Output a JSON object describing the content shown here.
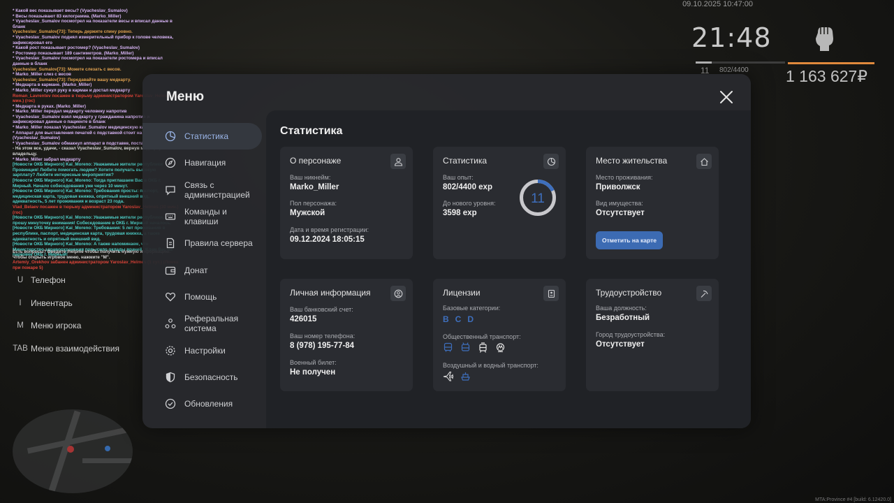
{
  "hud": {
    "date": "09.10.2025 10:47:00",
    "time": "21:48",
    "level": "11",
    "exp": "802/4400",
    "money": "1 163 627₽",
    "build": "MTA:Province #4 [build: 6.12420.0]"
  },
  "chat": [
    {
      "t": "* Какой вес показывает весы? (Vyacheslav_Sumalov)",
      "c": "c-sys"
    },
    {
      "t": "* Весы показывают 83 килограмма. (Marko_Miller)",
      "c": "c-sys"
    },
    {
      "t": "* Vyacheslav_Sumalov посмотрел на показатели весы и вписал данные в бланк",
      "c": "c-sys"
    },
    {
      "t": "Vyacheslav_Sumalov[73]: Теперь держите спину ровно.",
      "c": "c-orange"
    },
    {
      "t": "* Vyacheslav_Sumalov поднял измерительный прибор к голове человека, зафиксировал его",
      "c": "c-sys"
    },
    {
      "t": "* Какой рост показывает ростомер? (Vyacheslav_Sumalov)",
      "c": "c-sys"
    },
    {
      "t": "* Ростомер показывает 189 сантиметров. (Marko_Miller)",
      "c": "c-sys"
    },
    {
      "t": "* Vyacheslav_Sumalov посмотрел на показатели ростомера и вписал данные в бланк",
      "c": "c-sys"
    },
    {
      "t": "Vyacheslav_Sumalov[73]: Можете слезать с весов.",
      "c": "c-orange"
    },
    {
      "t": "* Marko_Miller слез с весов",
      "c": "c-sys"
    },
    {
      "t": "Vyacheslav_Sumalov[73]: Передавайте вашу медкарту.",
      "c": "c-orange"
    },
    {
      "t": "* Медкарта в кармане. (Marko_Miller)",
      "c": "c-sys"
    },
    {
      "t": "* Marko_Miller сунул руку в карман и достал медкарту",
      "c": "c-sys"
    },
    {
      "t": "Roman_Lavrentev посажен в тюрьму администратором Yaroslav_Helmes (30 мин.) (гос)",
      "c": "c-adm"
    },
    {
      "t": "* Медкарта в руках. (Marko_Miller)",
      "c": "c-sys"
    },
    {
      "t": "* Marko_Miller передал медкарту человеку напротив",
      "c": "c-sys"
    },
    {
      "t": "* Vyacheslav_Sumalov взял медкарту у гражданина напротив и зафиксировал данные о пациенте в бланк",
      "c": "c-sys"
    },
    {
      "t": "* Marko_Miller показал Vyacheslav_Sumalov медицинскую карту",
      "c": "c-sys"
    },
    {
      "t": "* Аппарат для выставления печатей с подставкой стоит на столе. (Vyacheslav_Sumalov)",
      "c": "c-sys"
    },
    {
      "t": "* Vyacheslav_Sumalov обмакнул аппарат в подставке, поставил печать",
      "c": "c-sys"
    },
    {
      "t": "- На этом все, удачи, - сказал Vyacheslav_Sumalov, вернув медкарту владельцу.",
      "c": "c-white"
    },
    {
      "t": "* Marko_Miller забрал медкарту",
      "c": "c-sys"
    },
    {
      "t": "[Новости ОКБ Мирного] Kai_Moreno: Уважаемые жители республики Провинция! Любите помогать людям? Хотите получать высокую зарплату? Любите интересные мероприятия?",
      "c": "c-news"
    },
    {
      "t": "[Новости ОКБ Мирного] Kai_Moreno: Тогда приглашаем Вас в ОКБ г. Мирный. Начало собеседования уже через 10 минут.",
      "c": "c-news"
    },
    {
      "t": "[Новости ОКБ Мирного] Kai_Moreno: Требования просты: паспорт, медицинская карта, трудовая книжка, опрятный внешний вид, адекватность, 5 лет проживания и возраст 23 года.",
      "c": "c-news"
    },
    {
      "t": "Vlad_Belaev посажен в тюрьму администратором Yaroslav_Helmes (30 мин.) (гос)",
      "c": "c-adm"
    },
    {
      "t": "[Новости ОКБ Мирного] Kai_Moreno: Уважаемые жители республики, прошу минуточку внимания! Собеседование в ОКБ г. Мирный началось.",
      "c": "c-news"
    },
    {
      "t": "[Новости ОКБ Мирного] Kai_Moreno: Требования: 5 лет проживания в республике, паспорт, медицинская карта, трудовая книжка, а также адекватность и опрятный внешний вид.",
      "c": "c-news"
    },
    {
      "t": "[Новости ОКБ Мирного] Kai_Moreno: А также напоминаем, что Министерство здравоохранения повысило оклады врачей. Ждем Вас на парковке ОКБ г. Мирный!",
      "c": "c-news"
    }
  ],
  "hint": [
    {
      "t": "Есть вопросы? Введите /helpme чтобы получить нужную информацию.",
      "c": "c-white"
    },
    {
      "t": "Чтобы открыть игровое меню, нажмите \"M\".",
      "c": "c-white"
    },
    {
      "t": "Artemiy_Orekhov забанен администратором Yaroslav_Helmes (1 сут.) (Ломка при пожаре 5)",
      "c": "c-adm"
    }
  ],
  "keybinds": [
    {
      "key": "U",
      "label": "Телефон"
    },
    {
      "key": "I",
      "label": "Инвентарь"
    },
    {
      "key": "M",
      "label": "Меню игрока"
    },
    {
      "key": "TAB",
      "label": "Меню взаимодействия"
    }
  ],
  "menu": {
    "title": "Меню",
    "nav": [
      {
        "label": "Статистика",
        "icon": "pie-chart-icon",
        "active": true
      },
      {
        "label": "Навигация",
        "icon": "compass-icon"
      },
      {
        "label": "Связь с администрацией",
        "icon": "chat-icon"
      },
      {
        "label": "Команды и клавиши",
        "icon": "keyboard-icon"
      },
      {
        "label": "Правила сервера",
        "icon": "document-icon"
      },
      {
        "label": "Донат",
        "icon": "wallet-icon"
      },
      {
        "label": "Помощь",
        "icon": "heart-hand-icon"
      },
      {
        "label": "Реферальная система",
        "icon": "network-icon"
      },
      {
        "label": "Настройки",
        "icon": "gear-icon"
      },
      {
        "label": "Безопасность",
        "icon": "shield-icon"
      },
      {
        "label": "Обновления",
        "icon": "check-circle-icon"
      }
    ],
    "content_title": "Статистика",
    "cards": {
      "persona": {
        "title": "О персонаже",
        "nick_label": "Ваш никнейм:",
        "nick": "Marko_Miller",
        "sex_label": "Пол персонажа:",
        "sex": "Мужской",
        "reg_label": "Дата и время регистрации:",
        "reg": "09.12.2024 18:05:15"
      },
      "stats": {
        "title": "Статистика",
        "exp_label": "Ваш опыт:",
        "exp": "802/4400 exp",
        "next_label": "До нового уровня:",
        "next": "3598 exp",
        "level": "11",
        "progress": 0.18
      },
      "residence": {
        "title": "Место жительства",
        "place_label": "Место проживания:",
        "place": "Приволжск",
        "prop_label": "Вид имущества:",
        "prop": "Отсутствует",
        "button": "Отметить на карте"
      },
      "personal": {
        "title": "Личная информация",
        "bank_label": "Ваш банковский счет:",
        "bank": "426015",
        "phone_label": "Ваш номер телефона:",
        "phone": "8 (978) 195-77-84",
        "mil_label": "Военный билет:",
        "mil": "Не получен"
      },
      "licenses": {
        "title": "Лицензии",
        "basic_label": "Базовые категории:",
        "basic": [
          "B",
          "C",
          "D"
        ],
        "public_label": "Общественный транспорт:",
        "air_label": "Воздушный и водный транспорт:"
      },
      "job": {
        "title": "Трудоустройство",
        "pos_label": "Ваша должность:",
        "pos": "Безработный",
        "city_label": "Город трудоустройства:",
        "city": "Отсутствует"
      }
    }
  },
  "colors": {
    "accent": "#3c6bb3",
    "panel": "#2a2c31",
    "content_bg": "#202226",
    "window_bg": "#28292d"
  }
}
